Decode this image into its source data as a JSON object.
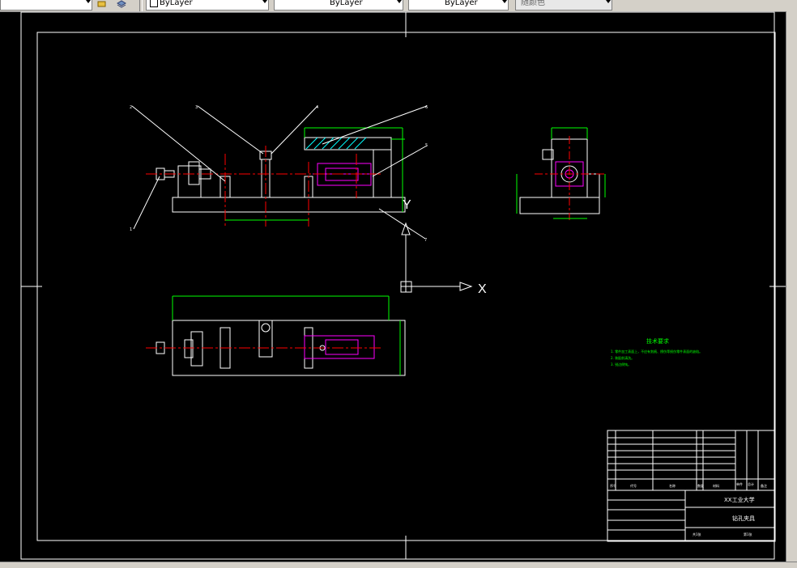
{
  "toolbar": {
    "layer_dropdown_1": "ByLayer",
    "layer_dropdown_2": "ByLayer",
    "layer_dropdown_3": "ByLayer",
    "color_dropdown": "随颜色"
  },
  "ucs": {
    "x_label": "X",
    "y_label": "Y"
  },
  "balloons": [
    "1",
    "2",
    "3",
    "4",
    "5",
    "6",
    "7"
  ],
  "tech_requirements": {
    "title": "技术要求",
    "items": [
      "1. 零件加工表面上，不应有划痕、擦伤等损伤零件表面的缺陷。",
      "2. 装配前清洗。",
      "3. 锐边倒钝。"
    ]
  },
  "title_block": {
    "school": "XX工业大学",
    "drawing_name": "钻孔夹具",
    "headers": [
      "序号",
      "代号",
      "名称",
      "数量",
      "材料",
      "单件",
      "总计",
      "备注"
    ],
    "sheet_label": "共1张",
    "sheet_no": "第1张"
  },
  "colors": {
    "outline": "#ffffff",
    "center": "#ff0000",
    "dimension": "#00ff00",
    "hidden": "#ff00ff",
    "cyan": "#00ffff",
    "note": "#00ff00"
  }
}
